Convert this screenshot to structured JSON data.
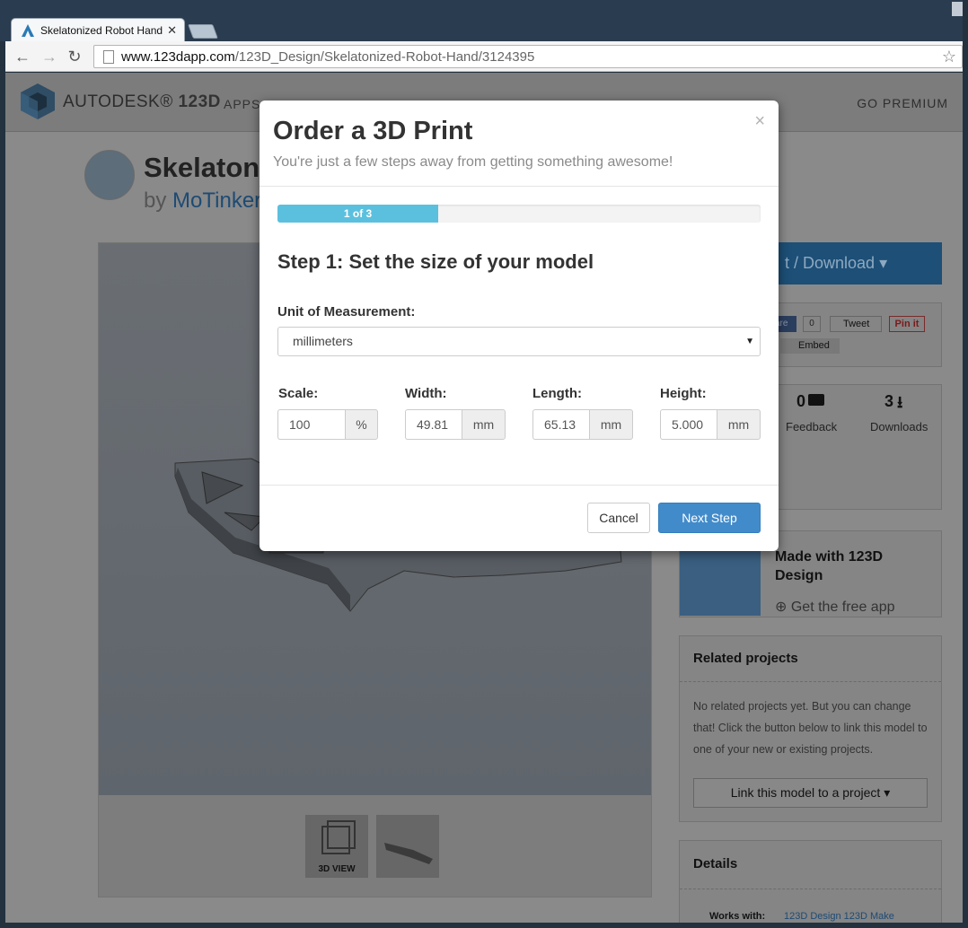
{
  "browser": {
    "tab_title": "Skelatonized Robot Hand",
    "url_host": "www.123dapp.com",
    "url_path": "/123D_Design/Skelatonized-Robot-Hand/3124395"
  },
  "site": {
    "brand": "AUTODESK",
    "brand_product": "123D",
    "nav_apps": "APPS",
    "go_premium": "GO PREMIUM"
  },
  "project": {
    "title_visible": "Skelatoniz",
    "by": "by",
    "author_visible": "MoTinker",
    "download_label": "t / Download",
    "thumb_3d_label": "3D VIEW",
    "embed": "Embed",
    "tweet": "Tweet",
    "pinit": "Pin it",
    "share_count": "0",
    "share_label": "are",
    "stats": [
      {
        "value": "0",
        "label": "Feedback"
      },
      {
        "value": "3",
        "label": "Downloads"
      }
    ],
    "made_with": "Made with 123D Design",
    "get_app": "Get the free app",
    "related_heading": "Related projects",
    "related_text": "No related projects yet. But you can change that! Click the button below to link this model to one of your new or existing projects.",
    "link_button": "Link this model to a project",
    "details_heading": "Details",
    "works_with_label": "Works with:",
    "works_with_value": "123D Design 123D Make"
  },
  "modal": {
    "title": "Order a 3D Print",
    "subtitle": "You're just a few steps away from getting something awesome!",
    "progress_label": "1 of 3",
    "progress_fraction": 0.333,
    "step_heading": "Step 1: Set the size of your model",
    "unit_label": "Unit of Measurement:",
    "unit_value": "millimeters",
    "fields": [
      {
        "label": "Scale:",
        "value": "100",
        "unit": "%"
      },
      {
        "label": "Width:",
        "value": "49.81",
        "unit": "mm"
      },
      {
        "label": "Length:",
        "value": "65.13",
        "unit": "mm"
      },
      {
        "label": "Height:",
        "value": "5.000",
        "unit": "mm"
      }
    ],
    "cancel_label": "Cancel",
    "next_label": "Next Step",
    "close_glyph": "×"
  },
  "colors": {
    "accent": "#428bca",
    "progress": "#5bc0de"
  }
}
